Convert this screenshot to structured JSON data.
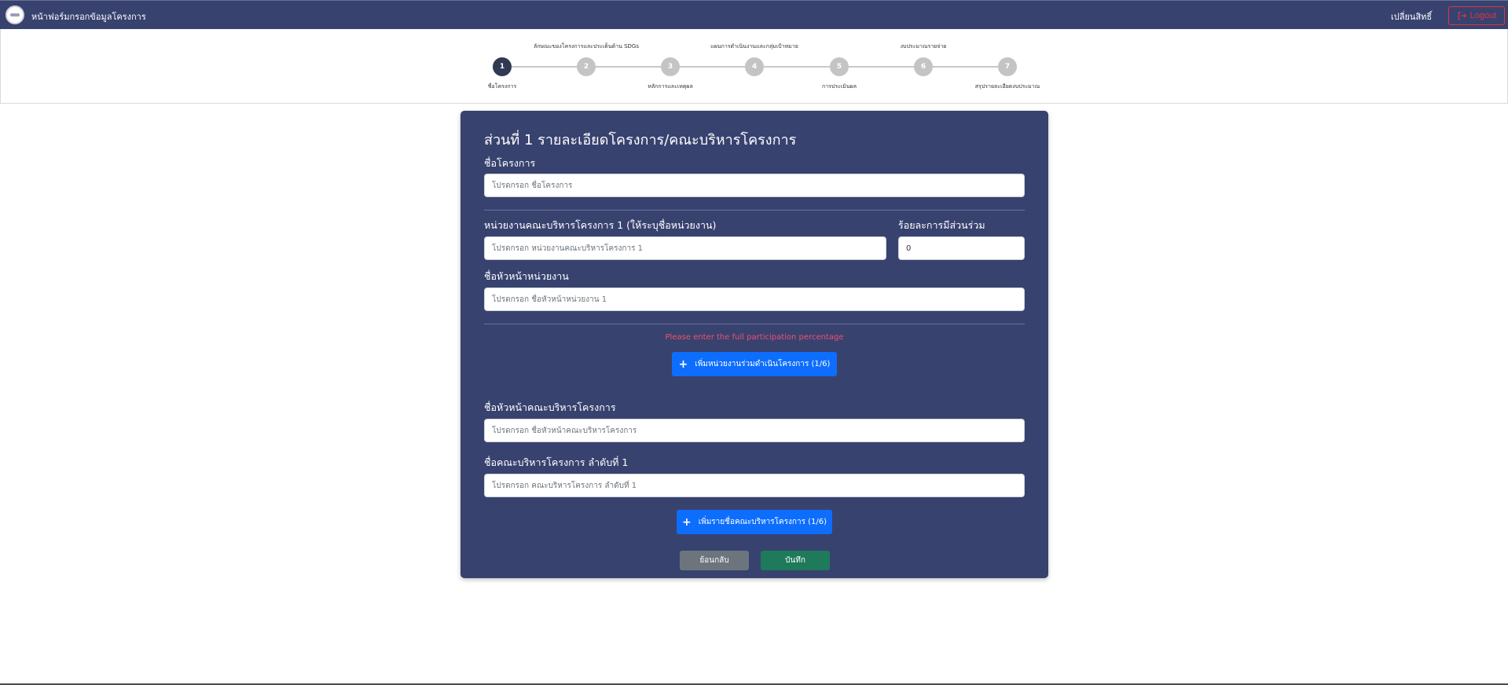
{
  "navbar": {
    "title": "หน้าฟอร์มกรอกข้อมูลโครงการ",
    "user_link": "เปลี่ยนสิทธิ์",
    "logout_label": "Logout"
  },
  "stepper": {
    "current_step": 1,
    "steps": [
      {
        "number": "1",
        "label": "ชื่อโครงการ"
      },
      {
        "number": "2",
        "label": "ลักษณะของโครงการและประเด็นด้าน SDGs"
      },
      {
        "number": "3",
        "label": "หลักการและเหตุผล"
      },
      {
        "number": "4",
        "label": "แผนการดำเนินงานและกลุ่มเป้าหมาย"
      },
      {
        "number": "5",
        "label": "การประเมินผล"
      },
      {
        "number": "6",
        "label": "งบประมาณรายจ่าย"
      },
      {
        "number": "7",
        "label": "สรุปรายละเอียดงบประมาณ"
      }
    ]
  },
  "form": {
    "title": "ส่วนที่ 1 รายละเอียดโครงการ/คณะบริหารโครงการ",
    "project_name": {
      "label": "ชื่อโครงการ",
      "placeholder": "โปรดกรอก ชื่อโครงการ",
      "value": ""
    },
    "unit": {
      "label": "หน่วยงานคณะบริหารโครงการ 1 (ให้ระบุชื่อหน่วยงาน)",
      "placeholder": "โปรดกรอก หน่วยงานคณะบริหารโครงการ 1",
      "value": ""
    },
    "participation": {
      "label": "ร้อยละการมีส่วนร่วม",
      "value": "0"
    },
    "unit_head": {
      "label": "ชื่อหัวหน้าหน่วยงาน",
      "placeholder": "โปรดกรอก ชื่อหัวหน้าหน่วยงาน 1",
      "value": ""
    },
    "error_message": "Please enter the full participation percentage",
    "add_unit_button": "เพิ่มหน่วยงานร่วมดำเนินโครงการ (1/6)",
    "committee_head": {
      "label": "ชื่อหัวหน้าคณะบริหารโครงการ",
      "placeholder": "โปรดกรอก ชื่อหัวหน้าคณะบริหารโครงการ",
      "value": ""
    },
    "committee_member": {
      "label": "ชื่อคณะบริหารโครงการ ลำดับที่ 1",
      "placeholder": "โปรดกรอก คณะบริหารโครงการ ลำดับที่ 1",
      "value": ""
    },
    "add_member_button": "เพิ่มรายชื่อคณะบริหารโครงการ (1/6)",
    "back_button": "ย้อนกลับ",
    "save_button": "บันทึก"
  },
  "colors": {
    "navbar_bg": "#38426f",
    "card_bg": "#38426f",
    "primary": "#0d6efd",
    "danger": "#dc3545",
    "success": "#1e7a5a",
    "secondary": "#6c757d",
    "step_active": "#2f3a52",
    "step_inactive": "#c4c4c4"
  },
  "icons": {
    "logo": "organization-logo",
    "logout": "logout-icon",
    "add": "plus-icon"
  }
}
